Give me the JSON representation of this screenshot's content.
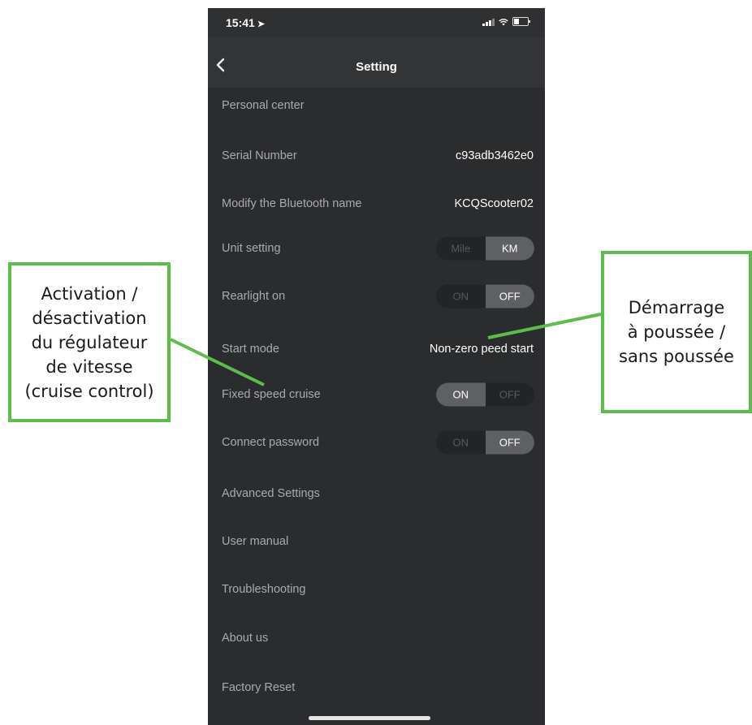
{
  "status_bar": {
    "time": "15:41",
    "location_arrow": "location-arrow-icon"
  },
  "nav": {
    "title": "Setting",
    "back_icon": "chevron-left-icon"
  },
  "settings": {
    "personal_center": {
      "label": "Personal center"
    },
    "serial_number": {
      "label": "Serial Number",
      "value": "c93adb3462e0"
    },
    "bluetooth_name": {
      "label": "Modify the Bluetooth name",
      "value": "KCQScooter02"
    },
    "unit_setting": {
      "label": "Unit setting",
      "options": [
        "Mile",
        "KM"
      ],
      "selected": "KM"
    },
    "rearlight": {
      "label": "Rearlight on",
      "options": [
        "ON",
        "OFF"
      ],
      "selected": "OFF"
    },
    "start_mode": {
      "label": "Start mode",
      "value": "Non-zero peed start"
    },
    "fixed_speed_cruise": {
      "label": "Fixed speed cruise",
      "options": [
        "ON",
        "OFF"
      ],
      "selected": "ON"
    },
    "connect_password": {
      "label": "Connect password",
      "options": [
        "ON",
        "OFF"
      ],
      "selected": "OFF"
    },
    "advanced_settings": {
      "label": "Advanced Settings"
    },
    "user_manual": {
      "label": "User manual"
    },
    "troubleshooting": {
      "label": "Troubleshooting"
    },
    "about_us": {
      "label": "About us"
    },
    "factory_reset": {
      "label": "Factory Reset"
    }
  },
  "annotations": {
    "cruise_control": "Activation /\ndésactivation\ndu régulateur\nde vitesse\n(cruise control)",
    "push_start": "Démarrage\nà poussée /\nsans poussée"
  },
  "colors": {
    "accent_green": "#5cbd4a",
    "background": "#2b2c2e",
    "toggle_active": "#5f6063"
  }
}
